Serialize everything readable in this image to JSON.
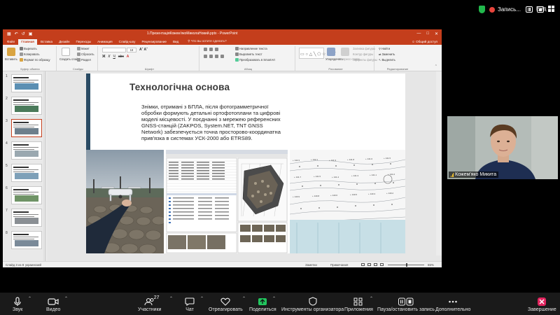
{
  "zoom_top": {
    "recording_label": "Запись...",
    "view_label": "Вид"
  },
  "ppt": {
    "doc_title": "1.ПрезентаціяКожем'якоМиколаНовий.pptx - PowerPoint",
    "tabs": [
      "Файл",
      "Главная",
      "Вставка",
      "Дизайн",
      "Переходы",
      "Анимация",
      "Слайд-шоу",
      "Рецензирование",
      "Вид"
    ],
    "active_tab_index": 1,
    "tell_me": "Что вы хотите сделать?",
    "share": "Общий доступ",
    "ribbon": {
      "paste": "Вставить",
      "cut": "Вырезать",
      "copy": "Копировать",
      "format_painter": "Формат по образцу",
      "clipboard_group": "Буфер обмена",
      "new_slide": "Создать слайд",
      "layout": "Макет",
      "reset": "Сбросить",
      "section": "Раздел",
      "slides_group": "Слайды",
      "font_group": "Шрифт",
      "text_direction": "Направление текста",
      "align_text": "Выровнять текст",
      "convert_smartart": "Преобразовать в SmartArt",
      "paragraph_group": "Абзац",
      "arrange": "Упорядочить",
      "quick_styles": "Экспресс-стили",
      "shape_fill": "Заливка фигуры",
      "shape_outline": "Контур фигуры",
      "shape_effects": "Эффекты фигуры",
      "drawing_group": "Рисование",
      "find": "Найти",
      "replace": "Заменить",
      "select": "Выделить",
      "editing_group": "Редактирование",
      "font_size": "18"
    },
    "thumbnails": [
      {
        "num": "1",
        "color": "#5b8fb3"
      },
      {
        "num": "2",
        "color": "#4a7a5a"
      },
      {
        "num": "3",
        "color": "#6d7f8c"
      },
      {
        "num": "4",
        "color": "#9aa8b0"
      },
      {
        "num": "5",
        "color": "#7ea0b8"
      },
      {
        "num": "6",
        "color": "#6f9366"
      },
      {
        "num": "7",
        "color": "#8a8f94"
      },
      {
        "num": "8",
        "color": "#7a8a99"
      }
    ],
    "selected_thumb": 3,
    "slide": {
      "title": "Технологічна основа",
      "lines": [
        "Знімки, отримані з БПЛА, після фотограмметричної",
        "обробки формують детальні ортофотоплани та цифрові",
        "моделі місцевості. У поєднанні з мережею референсних",
        "GNSS-станцій (ZAKPOS, System.NET, TNT GNSS",
        "Network) забезпечується точна просторово-координатна",
        "прив'язка в системах УСК-2000 або ETRS89."
      ]
    },
    "status": {
      "slide_counter": "Слайд 3 из 8",
      "language": "украинский",
      "notes": "Заметки",
      "comments": "Примечания",
      "zoom": "65%"
    }
  },
  "webcam": {
    "name": "Кожем'яко Микита"
  },
  "toolbar": {
    "items": [
      {
        "label": "Звук"
      },
      {
        "label": "Видео"
      },
      {
        "label": "Участники",
        "count": "27"
      },
      {
        "label": "Чат"
      },
      {
        "label": "Отреагировать"
      },
      {
        "label": "Поделиться"
      },
      {
        "label": "Инструменты организатора"
      },
      {
        "label": "Приложения"
      },
      {
        "label": "Пауза/остановить запись"
      },
      {
        "label": "Дополнительно"
      },
      {
        "label": "Завершение"
      }
    ]
  },
  "colors": {
    "ppt_accent": "#c43e1c",
    "share_green": "#22c55e",
    "end_red": "#e0245e",
    "slide_accent": "#2a4b64"
  }
}
